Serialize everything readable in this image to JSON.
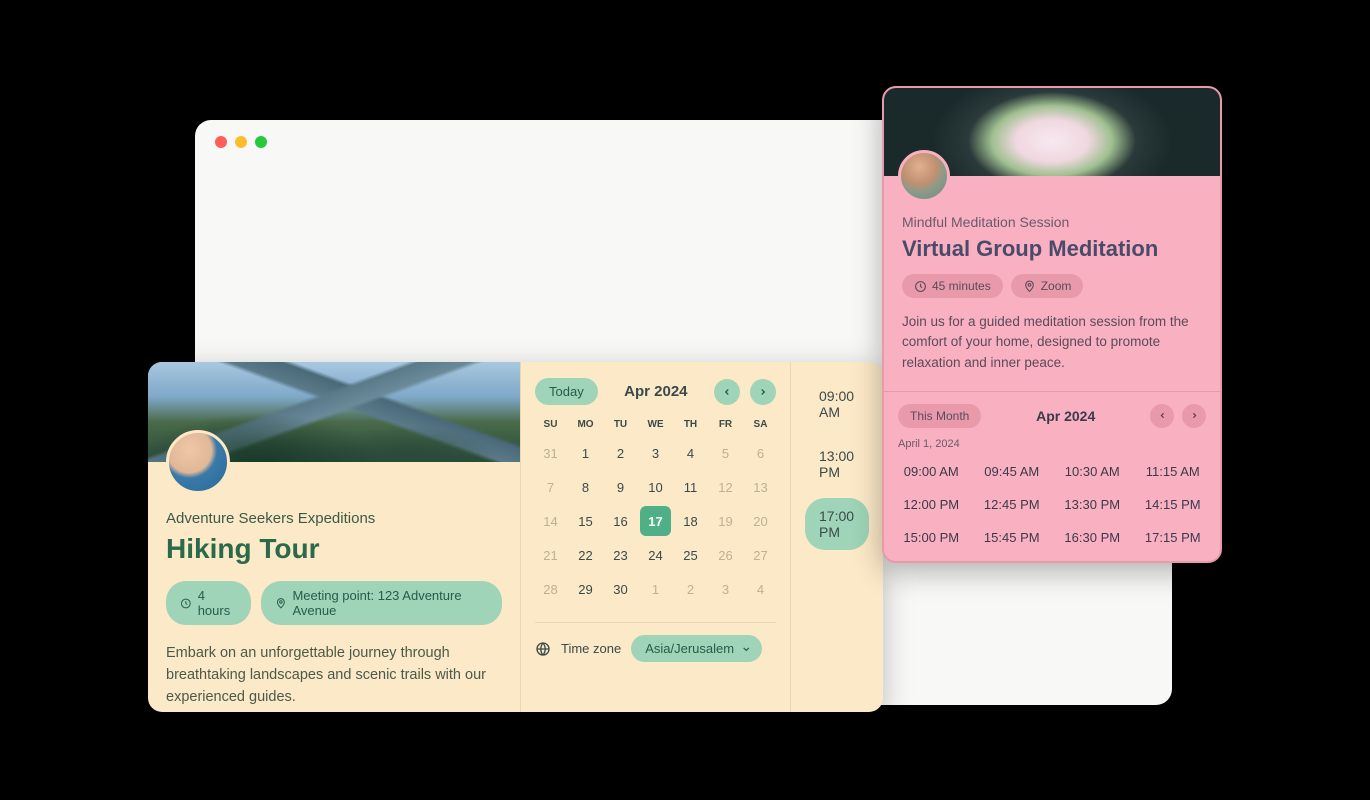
{
  "hiking": {
    "company": "Adventure Seekers Expeditions",
    "title": "Hiking Tour",
    "duration": "4 hours",
    "meeting_point": "Meeting point: 123 Adventure Avenue",
    "description": "Embark on an unforgettable journey through breathtaking landscapes and scenic trails with our experienced guides.",
    "today_label": "Today",
    "month_label": "Apr 2024",
    "dow": [
      "SU",
      "MO",
      "TU",
      "WE",
      "TH",
      "FR",
      "SA"
    ],
    "days": [
      {
        "n": "31",
        "muted": true
      },
      {
        "n": "1"
      },
      {
        "n": "2"
      },
      {
        "n": "3"
      },
      {
        "n": "4"
      },
      {
        "n": "5",
        "muted": true
      },
      {
        "n": "6",
        "muted": true
      },
      {
        "n": "7",
        "muted": true
      },
      {
        "n": "8"
      },
      {
        "n": "9"
      },
      {
        "n": "10"
      },
      {
        "n": "11"
      },
      {
        "n": "12",
        "muted": true
      },
      {
        "n": "13",
        "muted": true
      },
      {
        "n": "14",
        "muted": true
      },
      {
        "n": "15"
      },
      {
        "n": "16"
      },
      {
        "n": "17",
        "selected": true
      },
      {
        "n": "18"
      },
      {
        "n": "19",
        "muted": true
      },
      {
        "n": "20",
        "muted": true
      },
      {
        "n": "21",
        "muted": true
      },
      {
        "n": "22"
      },
      {
        "n": "23"
      },
      {
        "n": "24"
      },
      {
        "n": "25"
      },
      {
        "n": "26",
        "muted": true
      },
      {
        "n": "27",
        "muted": true
      },
      {
        "n": "28",
        "muted": true
      },
      {
        "n": "29"
      },
      {
        "n": "30"
      },
      {
        "n": "1",
        "muted": true
      },
      {
        "n": "2",
        "muted": true
      },
      {
        "n": "3",
        "muted": true
      },
      {
        "n": "4",
        "muted": true
      }
    ],
    "tz_label": "Time zone",
    "tz_value": "Asia/Jerusalem",
    "time_slots": [
      {
        "t": "09:00 AM",
        "selected": false
      },
      {
        "t": "13:00 PM",
        "selected": false
      },
      {
        "t": "17:00 PM",
        "selected": true
      }
    ]
  },
  "meditation": {
    "company": "Mindful Meditation Session",
    "title": "Virtual Group Meditation",
    "duration": "45 minutes",
    "location": "Zoom",
    "description": "Join us for a guided meditation session from the comfort of your home, designed to promote relaxation and inner peace.",
    "this_month_label": "This Month",
    "month_label": "Apr 2024",
    "date_label": "April 1, 2024",
    "times": [
      "09:00 AM",
      "09:45 AM",
      "10:30 AM",
      "11:15 AM",
      "12:00 PM",
      "12:45 PM",
      "13:30 PM",
      "14:15 PM",
      "15:00 PM",
      "15:45 PM",
      "16:30 PM",
      "17:15 PM"
    ]
  }
}
